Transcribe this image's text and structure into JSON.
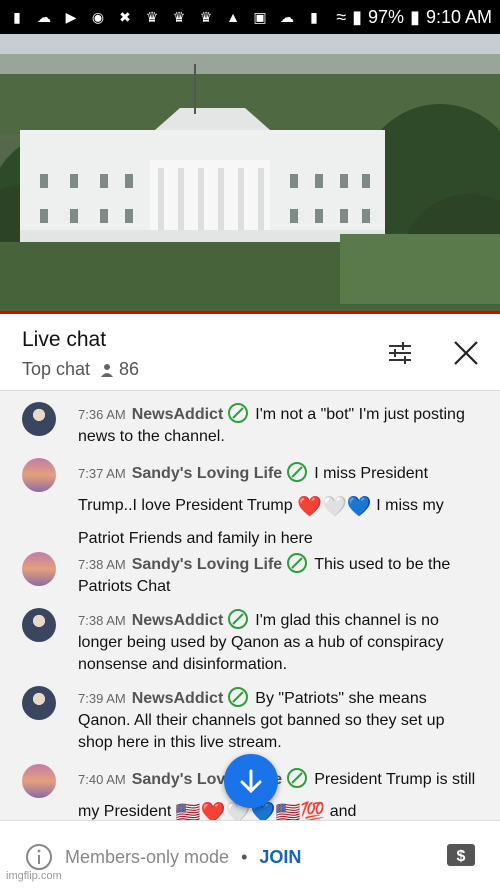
{
  "status_bar": {
    "battery": "97%",
    "time": "9:10 AM",
    "icons": [
      "chat-bubble-icon",
      "cloud-icon",
      "youtube-icon",
      "messenger-icon",
      "network-icon",
      "crown-icon",
      "crown-icon",
      "crown-icon",
      "warning-icon",
      "image-icon",
      "cloud-icon",
      "bag-icon",
      "wifi-icon",
      "signal-icon"
    ]
  },
  "video": {
    "scene": "white-house-livestream"
  },
  "chat_header": {
    "title": "Live chat",
    "mode": "Top chat",
    "viewer_count": "86",
    "icons": [
      "settings-sliders-icon",
      "close-icon",
      "person-icon"
    ]
  },
  "messages": [
    {
      "time": "7:36 AM",
      "author": "NewsAddict",
      "avatar": "newsaddict-avatar",
      "text_1": "I'm not a \"bot\" I'm just posting news to the channel."
    },
    {
      "time": "7:37 AM",
      "author": "Sandy's Loving Life",
      "avatar": "sandy-avatar",
      "text_1": "I miss President Trump..I love President Trump",
      "emoji_1": "❤️🤍💙",
      "text_2": "I miss my Patriot Friends and family in here"
    },
    {
      "time": "7:38 AM",
      "author": "Sandy's Loving Life",
      "avatar": "sandy-avatar",
      "text_1": "This used to be the Patriots Chat"
    },
    {
      "time": "7:38 AM",
      "author": "NewsAddict",
      "avatar": "newsaddict-avatar",
      "text_1": "I'm glad this channel is no longer being used by Qanon as a hub of conspiracy nonsense and disinformation."
    },
    {
      "time": "7:39 AM",
      "author": "NewsAddict",
      "avatar": "newsaddict-avatar",
      "text_1": "By \"Patriots\" she means Qanon. All their channels got banned so they set up shop here in this live stream."
    },
    {
      "time": "7:40 AM",
      "author": "Sandy's Loving Life",
      "avatar": "sandy-avatar",
      "text_1": "President Trump is still my President",
      "emoji_1": "🇺🇸❤️🤍💙🇺🇸💯",
      "text_2": "and"
    }
  ],
  "footer": {
    "members_mode": "Members-only mode",
    "separator": "•",
    "join_label": "JOIN",
    "icons": [
      "info-icon",
      "super-chat-icon"
    ]
  },
  "watermark": "imgflip.com",
  "colors": {
    "accent": "#1a73e8",
    "progress": "#e00000",
    "badge": "#2e9e3f"
  }
}
